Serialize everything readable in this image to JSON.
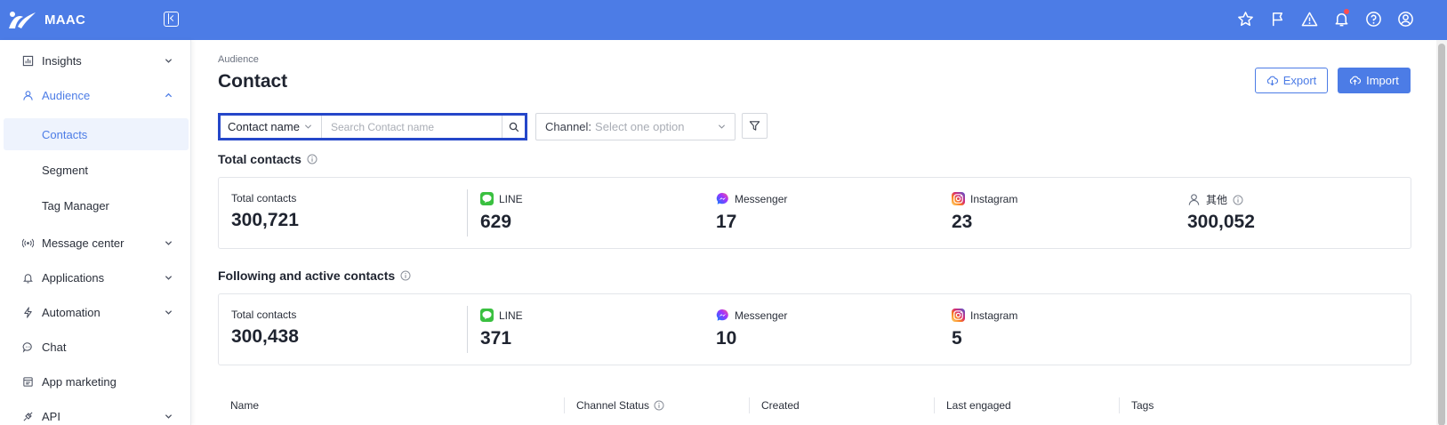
{
  "app": {
    "name": "MAAC"
  },
  "colors": {
    "brand": "#4c7ce6",
    "search_highlight": "#2547c9",
    "line_green": "#3ac040"
  },
  "sidebar": {
    "items": [
      {
        "label": "Insights",
        "icon": "chart-icon",
        "expandable": true
      },
      {
        "label": "Audience",
        "icon": "user-icon",
        "expandable": true,
        "expanded": true
      },
      {
        "label": "Contacts",
        "sub": true,
        "selected": true
      },
      {
        "label": "Segment",
        "sub": true
      },
      {
        "label": "Tag Manager",
        "sub": true
      },
      {
        "label": "Message center",
        "icon": "broadcast-icon",
        "expandable": true
      },
      {
        "label": "Applications",
        "icon": "bell-icon",
        "expandable": true
      },
      {
        "label": "Automation",
        "icon": "lightning-icon",
        "expandable": true
      },
      {
        "label": "Chat",
        "icon": "chat-icon"
      },
      {
        "label": "App marketing",
        "icon": "app-icon"
      },
      {
        "label": "API",
        "icon": "api-icon",
        "expandable": true
      }
    ]
  },
  "header": {
    "breadcrumb": "Audience",
    "title": "Contact",
    "export_label": "Export",
    "import_label": "Import"
  },
  "search": {
    "field_select": "Contact name",
    "placeholder": "Search Contact name",
    "value": ""
  },
  "channel_filter": {
    "label": "Channel:",
    "placeholder": "Select one option"
  },
  "total_contacts": {
    "title": "Total contacts",
    "total_label": "Total contacts",
    "total_value": "300,721",
    "channels": [
      {
        "name": "LINE",
        "value": "629",
        "icon": "line-icon"
      },
      {
        "name": "Messenger",
        "value": "17",
        "icon": "messenger-icon"
      },
      {
        "name": "Instagram",
        "value": "23",
        "icon": "instagram-icon"
      },
      {
        "name": "其他",
        "value": "300,052",
        "icon": "person-icon"
      }
    ]
  },
  "following_contacts": {
    "title": "Following and active contacts",
    "total_label": "Total contacts",
    "total_value": "300,438",
    "channels": [
      {
        "name": "LINE",
        "value": "371",
        "icon": "line-icon"
      },
      {
        "name": "Messenger",
        "value": "10",
        "icon": "messenger-icon"
      },
      {
        "name": "Instagram",
        "value": "5",
        "icon": "instagram-icon"
      }
    ]
  },
  "table": {
    "columns": [
      "Name",
      "Channel Status",
      "Created",
      "Last engaged",
      "Tags"
    ]
  }
}
